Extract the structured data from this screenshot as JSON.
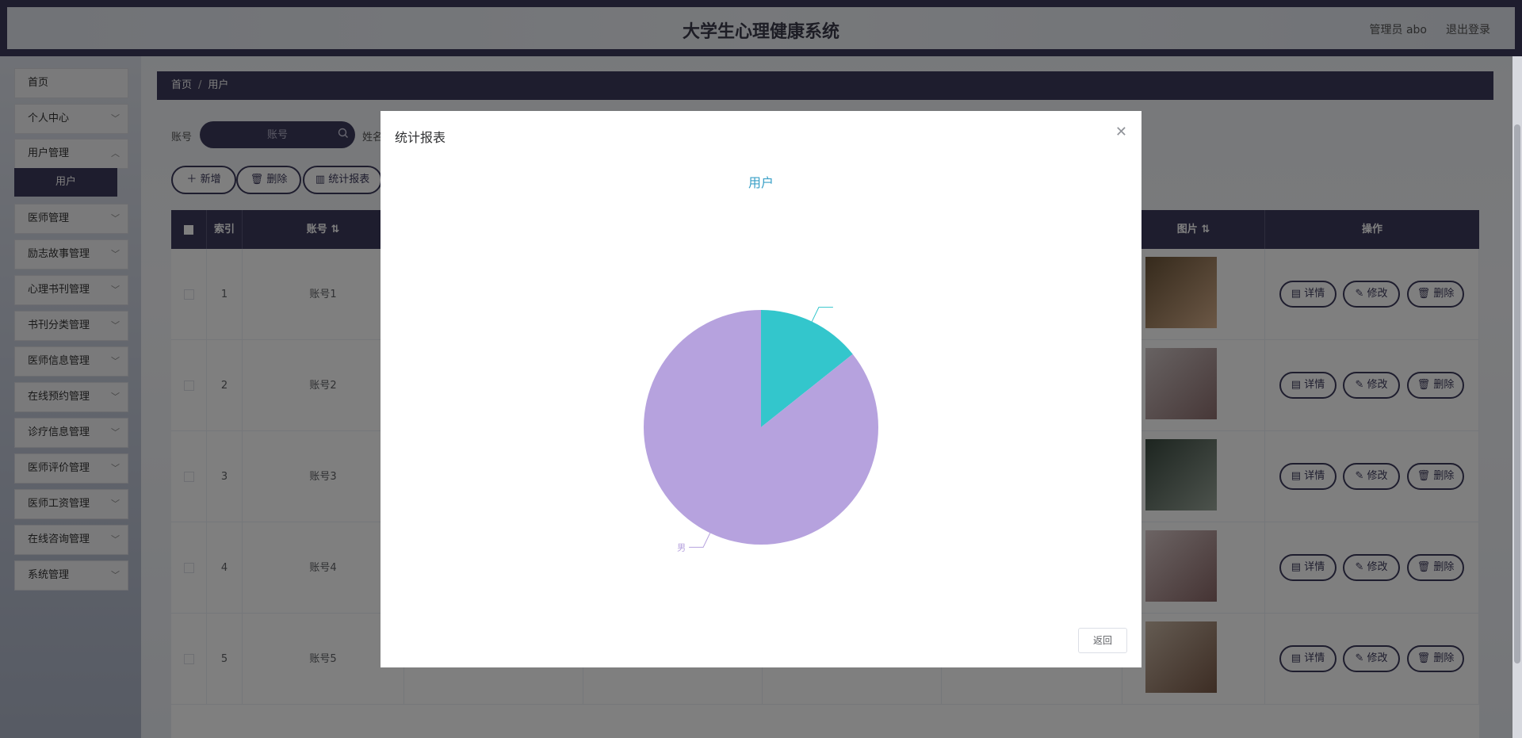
{
  "header": {
    "title": "大学生心理健康系统",
    "admin": "管理员 abo",
    "logout": "退出登录"
  },
  "sidebar": {
    "items": [
      {
        "label": "首页",
        "has_children": false
      },
      {
        "label": "个人中心",
        "has_children": true
      },
      {
        "label": "用户管理",
        "has_children": true
      },
      {
        "label": "医师管理",
        "has_children": true
      },
      {
        "label": "励志故事管理",
        "has_children": true
      },
      {
        "label": "心理书刊管理",
        "has_children": true
      },
      {
        "label": "书刊分类管理",
        "has_children": true
      },
      {
        "label": "医师信息管理",
        "has_children": true
      },
      {
        "label": "在线预约管理",
        "has_children": true
      },
      {
        "label": "诊疗信息管理",
        "has_children": true
      },
      {
        "label": "医师评价管理",
        "has_children": true
      },
      {
        "label": "医师工资管理",
        "has_children": true
      },
      {
        "label": "在线咨询管理",
        "has_children": true
      },
      {
        "label": "系统管理",
        "has_children": true
      }
    ],
    "active_sub": "用户"
  },
  "breadcrumb": {
    "home": "首页",
    "current": "用户"
  },
  "search": {
    "label": "账号",
    "placeholder": "账号",
    "label2": "姓名"
  },
  "toolbar": {
    "add": "新增",
    "delete": "删除",
    "report": "统计报表"
  },
  "table": {
    "headers": {
      "index": "索引",
      "account": "账号",
      "image": "图片",
      "actions": "操作"
    },
    "rows": [
      {
        "index": "1",
        "account": "账号1"
      },
      {
        "index": "2",
        "account": "账号2"
      },
      {
        "index": "3",
        "account": "账号3"
      },
      {
        "index": "4",
        "account": "账号4"
      },
      {
        "index": "5",
        "account": "账号5"
      }
    ],
    "row_actions": {
      "detail": "详情",
      "edit": "修改",
      "delete": "删除"
    }
  },
  "dialog": {
    "title": "统计报表",
    "back": "返回"
  },
  "chart_data": {
    "type": "pie",
    "title": "用户",
    "slices": [
      {
        "label": "",
        "value": 1,
        "color": "#33c6cc"
      },
      {
        "label": "男",
        "value": 6,
        "color": "#b6a2de"
      }
    ]
  },
  "colors": {
    "primary": "#3d3a5c",
    "chart_title": "#3aa0c7"
  }
}
